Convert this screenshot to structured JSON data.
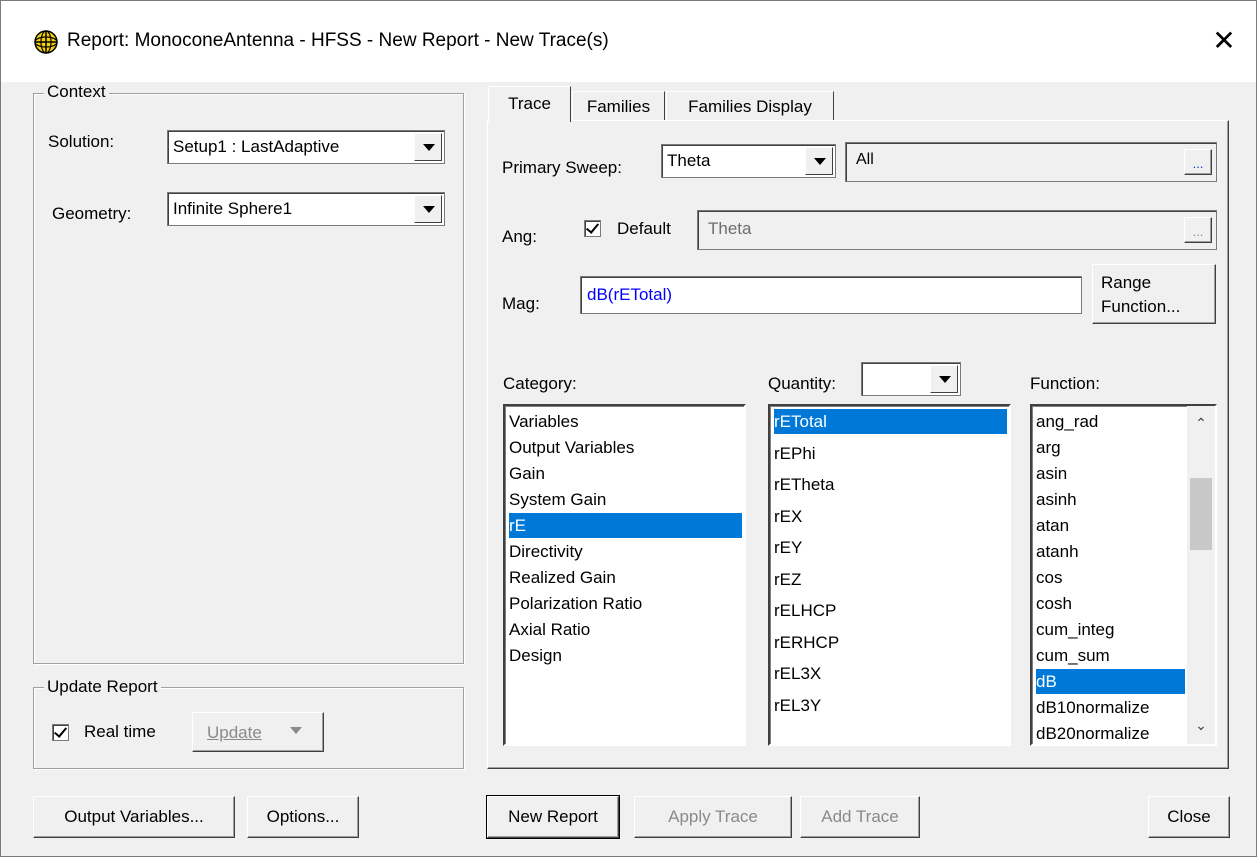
{
  "window": {
    "title": "Report: MonoconeAntenna - HFSS - New Report - New Trace(s)",
    "close_glyph": "✕"
  },
  "context": {
    "label": "Context",
    "solution_label": "Solution:",
    "solution_value": "Setup1 : LastAdaptive",
    "geometry_label": "Geometry:",
    "geometry_value": "Infinite Sphere1"
  },
  "update_report": {
    "label": "Update Report",
    "realtime_label": "Real time",
    "realtime_checked": true,
    "update_button": "Update"
  },
  "tabs": [
    {
      "label": "Trace",
      "active": true
    },
    {
      "label": "Families",
      "active": false
    },
    {
      "label": "Families Display",
      "active": false
    }
  ],
  "trace": {
    "primary_sweep_label": "Primary Sweep:",
    "primary_sweep_value": "Theta",
    "sweep_range_value": "All",
    "ellipsis": "...",
    "ang_label": "Ang:",
    "default_label": "Default",
    "default_checked": true,
    "ang_value": "Theta",
    "mag_label": "Mag:",
    "mag_value": "dB(rETotal)",
    "range_function_line1": "Range",
    "range_function_line2": "Function...",
    "category_label": "Category:",
    "quantity_label": "Quantity:",
    "quantity_filter_value": "",
    "function_label": "Function:",
    "categories": [
      "Variables",
      "Output Variables",
      "Gain",
      "System Gain",
      "rE",
      "Directivity",
      "Realized Gain",
      "Polarization Ratio",
      "Axial Ratio",
      "Design"
    ],
    "category_selected": "rE",
    "quantities": [
      "rETotal",
      "rEPhi",
      "rETheta",
      "rEX",
      "rEY",
      "rEZ",
      "rELHCP",
      "rERHCP",
      "rEL3X",
      "rEL3Y"
    ],
    "quantity_selected": "rETotal",
    "functions": [
      "ang_rad",
      "arg",
      "asin",
      "asinh",
      "atan",
      "atanh",
      "cos",
      "cosh",
      "cum_integ",
      "cum_sum",
      "dB",
      "dB10normalize",
      "dB20normalize"
    ],
    "function_selected": "dB"
  },
  "buttons": {
    "output_variables": "Output Variables...",
    "options": "Options...",
    "new_report": "New Report",
    "apply_trace": "Apply Trace",
    "add_trace": "Add Trace",
    "close": "Close"
  },
  "colors": {
    "selection": "#0078d7",
    "mag_text": "#0000ff"
  }
}
